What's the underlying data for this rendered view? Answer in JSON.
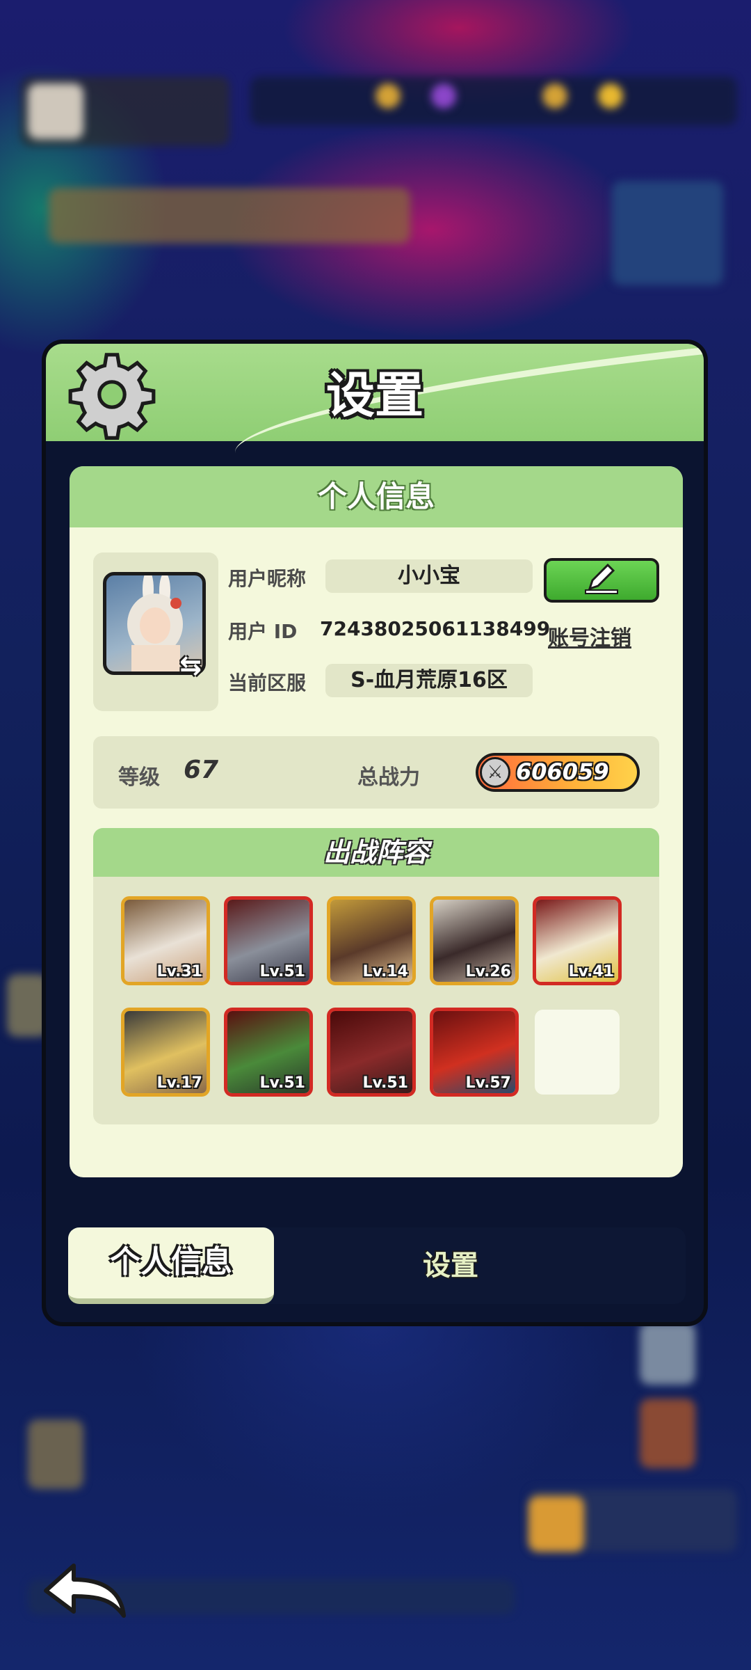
{
  "title": "设置",
  "card": {
    "header": "个人信息",
    "nickname_label": "用户昵称",
    "nickname": "小小宝",
    "id_label": "用户 ID",
    "id_value": "72438025061138499",
    "cancel_account": "账号注销",
    "server_label": "当前区服",
    "server": "S-血月荒原16区"
  },
  "stats": {
    "level_label": "等级",
    "level": "67",
    "power_label": "总战力",
    "power": "606059"
  },
  "lineup": {
    "header": "出战阵容",
    "heroes": [
      {
        "level": "Lv.31",
        "frame": "gold"
      },
      {
        "level": "Lv.51",
        "frame": "red"
      },
      {
        "level": "Lv.14",
        "frame": "gold"
      },
      {
        "level": "Lv.26",
        "frame": "gold"
      },
      {
        "level": "Lv.41",
        "frame": "red"
      },
      {
        "level": "Lv.17",
        "frame": "gold"
      },
      {
        "level": "Lv.51",
        "frame": "red"
      },
      {
        "level": "Lv.51",
        "frame": "red"
      },
      {
        "level": "Lv.57",
        "frame": "red"
      }
    ]
  },
  "tabs": {
    "active": "个人信息",
    "inactive": "设置"
  },
  "icons": {
    "gear": "gear-icon",
    "edit": "pencil-icon",
    "swap": "swap-icon",
    "power": "swords-icon",
    "back": "back-arrow-icon"
  }
}
